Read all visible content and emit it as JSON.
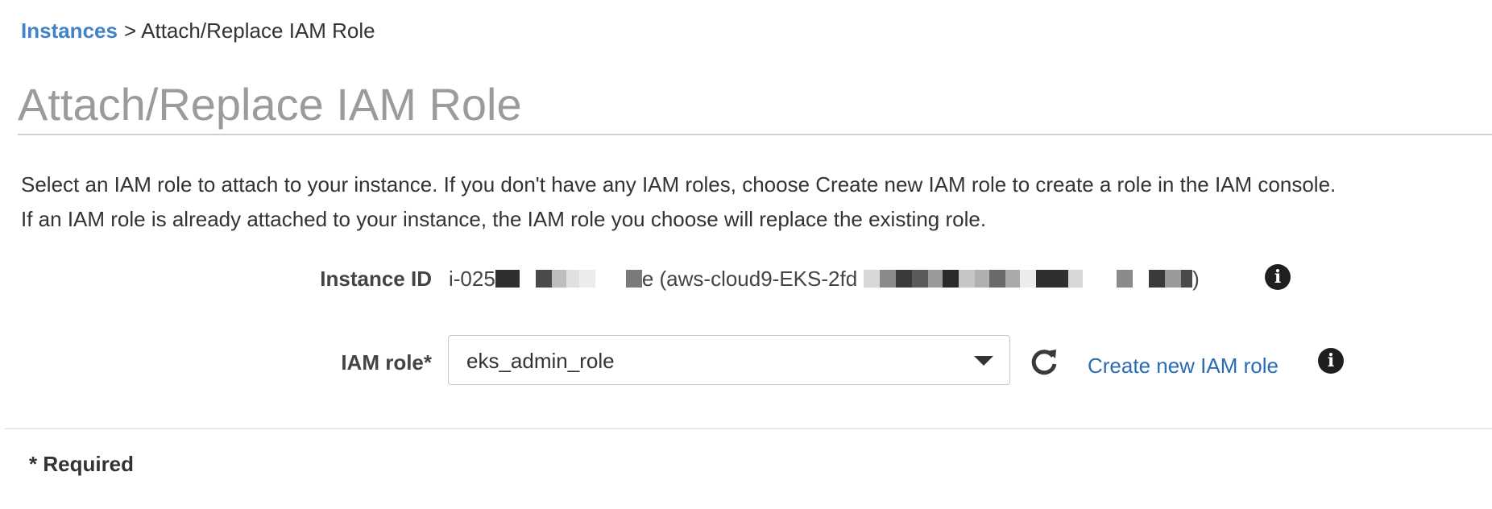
{
  "breadcrumb": {
    "link": "Instances",
    "separator": ">",
    "current": "Attach/Replace IAM Role"
  },
  "page": {
    "title": "Attach/Replace IAM Role",
    "description_line1": "Select an IAM role to attach to your instance. If you don't have any IAM roles, choose Create new IAM role to create a role in the IAM console.",
    "description_line2": "If an IAM role is already attached to your instance, the IAM role you choose will replace the existing role."
  },
  "form": {
    "instance_id_label": "Instance ID",
    "instance_id_prefix": "i-025",
    "instance_name_prefix": "e (aws-cloud9-EKS-2fd",
    "instance_suffix": ")",
    "iam_role_label": "IAM role*",
    "iam_role_value": "eks_admin_role",
    "create_role_link": "Create new IAM role",
    "info_icon_glyph": "i"
  },
  "footer": {
    "required_note": "* Required"
  },
  "colors": {
    "link": "#3f84c8",
    "create_link": "#2a6cb6",
    "title": "#9b9b9b"
  },
  "icons": [
    "info-icon",
    "refresh-icon",
    "caret-down-icon"
  ]
}
